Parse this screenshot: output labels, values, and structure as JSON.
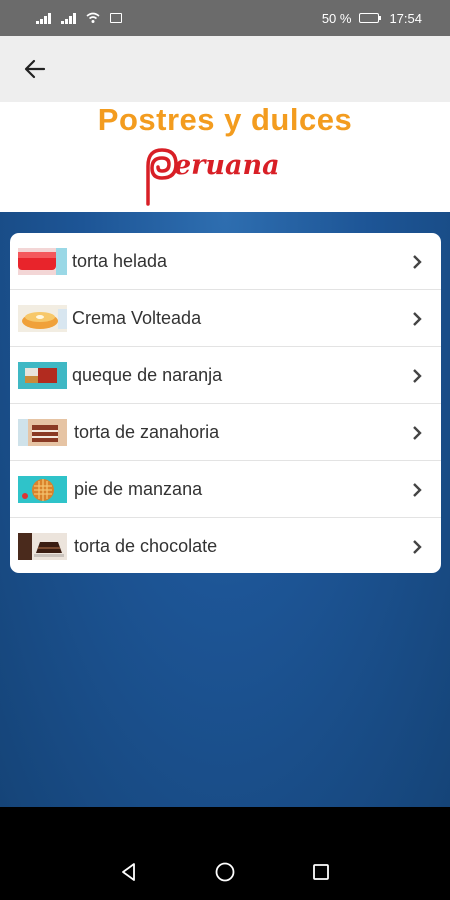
{
  "status_bar": {
    "battery_text": "50 %",
    "battery_level": 0.5,
    "time": "17:54"
  },
  "app_bar": {
    "back_icon": "arrow-back-icon"
  },
  "banner": {
    "title": "Postres y dulces",
    "logo_text": "eruana",
    "colors": {
      "title": "#f39c1f",
      "logo": "#d81f26"
    }
  },
  "menu": {
    "items": [
      {
        "label": "torta helada"
      },
      {
        "label": "Crema Volteada"
      },
      {
        "label": "queque de naranja"
      },
      {
        "label": "torta de zanahoria"
      },
      {
        "label": "pie de manzana"
      },
      {
        "label": "torta de chocolate"
      }
    ]
  },
  "colors": {
    "status_bar": "#6b6b6b",
    "app_bar": "#eeeeee",
    "background": "#1d5596",
    "card": "#ffffff"
  }
}
